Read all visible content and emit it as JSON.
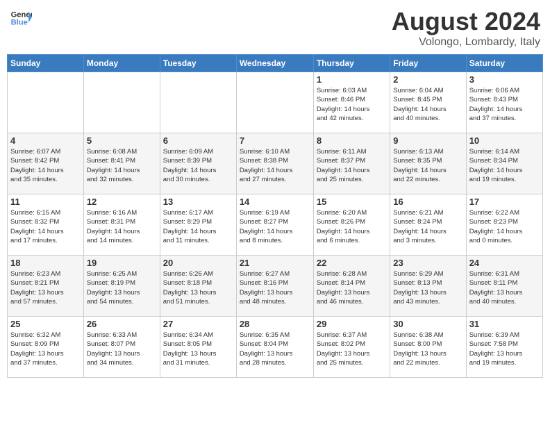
{
  "header": {
    "logo_line1": "General",
    "logo_line2": "Blue",
    "month_year": "August 2024",
    "location": "Volongo, Lombardy, Italy"
  },
  "weekdays": [
    "Sunday",
    "Monday",
    "Tuesday",
    "Wednesday",
    "Thursday",
    "Friday",
    "Saturday"
  ],
  "weeks": [
    [
      {
        "day": "",
        "info": ""
      },
      {
        "day": "",
        "info": ""
      },
      {
        "day": "",
        "info": ""
      },
      {
        "day": "",
        "info": ""
      },
      {
        "day": "1",
        "info": "Sunrise: 6:03 AM\nSunset: 8:46 PM\nDaylight: 14 hours\nand 42 minutes."
      },
      {
        "day": "2",
        "info": "Sunrise: 6:04 AM\nSunset: 8:45 PM\nDaylight: 14 hours\nand 40 minutes."
      },
      {
        "day": "3",
        "info": "Sunrise: 6:06 AM\nSunset: 8:43 PM\nDaylight: 14 hours\nand 37 minutes."
      }
    ],
    [
      {
        "day": "4",
        "info": "Sunrise: 6:07 AM\nSunset: 8:42 PM\nDaylight: 14 hours\nand 35 minutes."
      },
      {
        "day": "5",
        "info": "Sunrise: 6:08 AM\nSunset: 8:41 PM\nDaylight: 14 hours\nand 32 minutes."
      },
      {
        "day": "6",
        "info": "Sunrise: 6:09 AM\nSunset: 8:39 PM\nDaylight: 14 hours\nand 30 minutes."
      },
      {
        "day": "7",
        "info": "Sunrise: 6:10 AM\nSunset: 8:38 PM\nDaylight: 14 hours\nand 27 minutes."
      },
      {
        "day": "8",
        "info": "Sunrise: 6:11 AM\nSunset: 8:37 PM\nDaylight: 14 hours\nand 25 minutes."
      },
      {
        "day": "9",
        "info": "Sunrise: 6:13 AM\nSunset: 8:35 PM\nDaylight: 14 hours\nand 22 minutes."
      },
      {
        "day": "10",
        "info": "Sunrise: 6:14 AM\nSunset: 8:34 PM\nDaylight: 14 hours\nand 19 minutes."
      }
    ],
    [
      {
        "day": "11",
        "info": "Sunrise: 6:15 AM\nSunset: 8:32 PM\nDaylight: 14 hours\nand 17 minutes."
      },
      {
        "day": "12",
        "info": "Sunrise: 6:16 AM\nSunset: 8:31 PM\nDaylight: 14 hours\nand 14 minutes."
      },
      {
        "day": "13",
        "info": "Sunrise: 6:17 AM\nSunset: 8:29 PM\nDaylight: 14 hours\nand 11 minutes."
      },
      {
        "day": "14",
        "info": "Sunrise: 6:19 AM\nSunset: 8:27 PM\nDaylight: 14 hours\nand 8 minutes."
      },
      {
        "day": "15",
        "info": "Sunrise: 6:20 AM\nSunset: 8:26 PM\nDaylight: 14 hours\nand 6 minutes."
      },
      {
        "day": "16",
        "info": "Sunrise: 6:21 AM\nSunset: 8:24 PM\nDaylight: 14 hours\nand 3 minutes."
      },
      {
        "day": "17",
        "info": "Sunrise: 6:22 AM\nSunset: 8:23 PM\nDaylight: 14 hours\nand 0 minutes."
      }
    ],
    [
      {
        "day": "18",
        "info": "Sunrise: 6:23 AM\nSunset: 8:21 PM\nDaylight: 13 hours\nand 57 minutes."
      },
      {
        "day": "19",
        "info": "Sunrise: 6:25 AM\nSunset: 8:19 PM\nDaylight: 13 hours\nand 54 minutes."
      },
      {
        "day": "20",
        "info": "Sunrise: 6:26 AM\nSunset: 8:18 PM\nDaylight: 13 hours\nand 51 minutes."
      },
      {
        "day": "21",
        "info": "Sunrise: 6:27 AM\nSunset: 8:16 PM\nDaylight: 13 hours\nand 48 minutes."
      },
      {
        "day": "22",
        "info": "Sunrise: 6:28 AM\nSunset: 8:14 PM\nDaylight: 13 hours\nand 46 minutes."
      },
      {
        "day": "23",
        "info": "Sunrise: 6:29 AM\nSunset: 8:13 PM\nDaylight: 13 hours\nand 43 minutes."
      },
      {
        "day": "24",
        "info": "Sunrise: 6:31 AM\nSunset: 8:11 PM\nDaylight: 13 hours\nand 40 minutes."
      }
    ],
    [
      {
        "day": "25",
        "info": "Sunrise: 6:32 AM\nSunset: 8:09 PM\nDaylight: 13 hours\nand 37 minutes."
      },
      {
        "day": "26",
        "info": "Sunrise: 6:33 AM\nSunset: 8:07 PM\nDaylight: 13 hours\nand 34 minutes."
      },
      {
        "day": "27",
        "info": "Sunrise: 6:34 AM\nSunset: 8:05 PM\nDaylight: 13 hours\nand 31 minutes."
      },
      {
        "day": "28",
        "info": "Sunrise: 6:35 AM\nSunset: 8:04 PM\nDaylight: 13 hours\nand 28 minutes."
      },
      {
        "day": "29",
        "info": "Sunrise: 6:37 AM\nSunset: 8:02 PM\nDaylight: 13 hours\nand 25 minutes."
      },
      {
        "day": "30",
        "info": "Sunrise: 6:38 AM\nSunset: 8:00 PM\nDaylight: 13 hours\nand 22 minutes."
      },
      {
        "day": "31",
        "info": "Sunrise: 6:39 AM\nSunset: 7:58 PM\nDaylight: 13 hours\nand 19 minutes."
      }
    ]
  ]
}
